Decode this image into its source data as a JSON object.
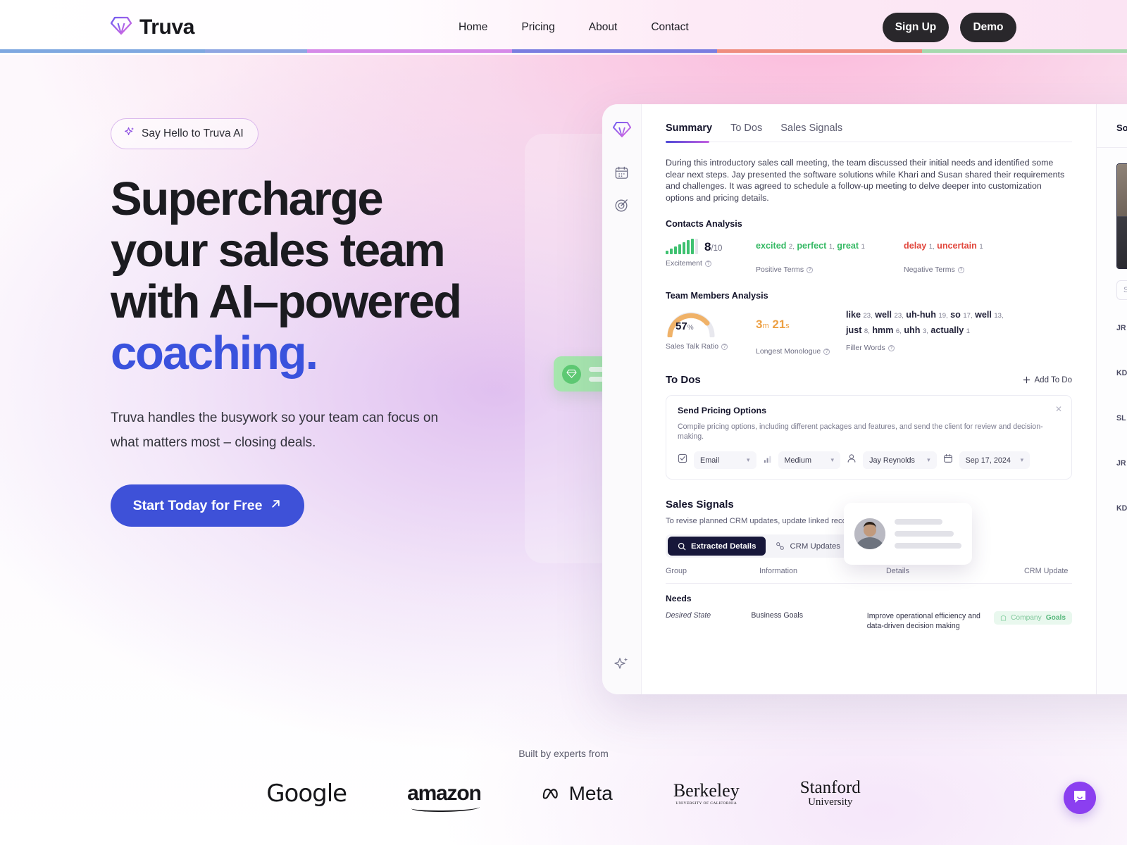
{
  "nav": {
    "brand": "Truva",
    "brand_icon": "diamond-logo-icon",
    "links": [
      {
        "label": "Home"
      },
      {
        "label": "Pricing"
      },
      {
        "label": "About"
      },
      {
        "label": "Contact"
      }
    ],
    "signup_label": "Sign Up",
    "demo_label": "Demo",
    "gradient_segments": [
      "#7fa8e0",
      "#7fa8e0",
      "#8fa6e2",
      "#d68ae8",
      "#d68ae8",
      "#7b7de0",
      "#7b7de0",
      "#ef8d7f",
      "#ef8d7f",
      "#a6d9ae",
      "#a6d9ae"
    ]
  },
  "hero": {
    "badge_icon": "sparkle-icon",
    "badge_label": "Say Hello to Truva AI",
    "title_line1": "Supercharge",
    "title_line2": "your sales team",
    "title_line3": "with AI–powered",
    "title_accent": "coaching.",
    "accent_color": "#3a52dd",
    "subtitle": "Truva handles the busywork so your team can focus on what matters most – closing deals.",
    "cta_label": "Start Today for Free",
    "cta_icon": "arrow-up-right-icon",
    "cta_color": "#3e51d8"
  },
  "dashboard": {
    "rail_icons": [
      "diamond-logo-icon",
      "calendar-icon",
      "target-icon",
      "sparkle-ai-icon"
    ],
    "tabs": [
      {
        "label": "Summary",
        "active": true
      },
      {
        "label": "To Dos",
        "active": false
      },
      {
        "label": "Sales Signals",
        "active": false
      }
    ],
    "summary_text": "During this introductory sales call meeting, the team discussed their initial needs and identified some clear next steps. Jay presented the software solutions while Khari and Susan shared their requirements and challenges. It was agreed to schedule a follow-up meeting to delve deeper into customization options and pricing details.",
    "contacts_analysis": {
      "heading": "Contacts Analysis",
      "excitement": {
        "value": "8",
        "out_of": "/10",
        "caption": "Excitement",
        "bars_filled": 7,
        "bars_total": 8
      },
      "positive": {
        "caption": "Positive Terms",
        "terms": [
          {
            "word": "excited",
            "count": "2"
          },
          {
            "word": "perfect",
            "count": "1"
          },
          {
            "word": "great",
            "count": "1"
          }
        ]
      },
      "negative": {
        "caption": "Negative Terms",
        "terms": [
          {
            "word": "delay",
            "count": "1"
          },
          {
            "word": "uncertain",
            "count": "1"
          }
        ]
      }
    },
    "team_analysis": {
      "heading": "Team Members Analysis",
      "talk_ratio": {
        "value": "57",
        "unit": "%",
        "caption": "Sales Talk Ratio",
        "percent": 57
      },
      "monologue": {
        "minutes": "3",
        "m_unit": "m",
        "seconds": "21",
        "s_unit": "s",
        "caption": "Longest Monologue"
      },
      "filler": {
        "caption": "Filler Words",
        "terms": [
          {
            "word": "like",
            "count": "23"
          },
          {
            "word": "well",
            "count": "23"
          },
          {
            "word": "uh-huh",
            "count": "19"
          },
          {
            "word": "so",
            "count": "17"
          },
          {
            "word": "well",
            "count": "13"
          },
          {
            "word": "just",
            "count": "8"
          },
          {
            "word": "hmm",
            "count": "6"
          },
          {
            "word": "uhh",
            "count": "3"
          },
          {
            "word": "actually",
            "count": "1"
          }
        ]
      }
    },
    "todos": {
      "heading": "To Dos",
      "add_label": "Add To Do",
      "add_icon": "plus-icon",
      "card": {
        "title": "Send Pricing Options",
        "description": "Compile pricing options, including different packages and features, and send the client for review and decision-making.",
        "close_icon": "close-icon",
        "controls": [
          {
            "icon": "checkbox-icon",
            "value": "Email"
          },
          {
            "icon": "priority-bars-icon",
            "value": "Medium"
          },
          {
            "icon": "person-icon",
            "value": "Jay Reynolds"
          },
          {
            "icon": "calendar-icon",
            "value": "Sep 17, 2024"
          }
        ]
      }
    },
    "sales_signals": {
      "heading": "Sales Signals",
      "description": "To revise planned CRM updates, update linked records using 'associations'.",
      "segments": [
        {
          "label": "Extracted Details",
          "icon": "search-icon",
          "active": true
        },
        {
          "label": "CRM Updates",
          "icon": "link-nodes-icon",
          "active": false
        }
      ],
      "columns": [
        "Group",
        "Information",
        "Details",
        "CRM Update"
      ],
      "group_label": "Needs",
      "rows": [
        {
          "group": "Desired State",
          "information": "Business Goals",
          "details": "Improve operational efficiency and data-driven decision making",
          "crm_update": {
            "icon": "company-icon",
            "label": "Company",
            "value": "Goals"
          }
        }
      ]
    },
    "source_panel": {
      "heading": "Source",
      "search_placeholder": "Se",
      "speakers": [
        "JR",
        "KD",
        "SL",
        "JR",
        "KD"
      ]
    }
  },
  "partners": {
    "caption": "Built by experts from",
    "logos": [
      {
        "name": "Google",
        "text": "Google"
      },
      {
        "name": "amazon",
        "text": "amazon"
      },
      {
        "name": "Meta",
        "text": "Meta"
      },
      {
        "name": "Berkeley",
        "text": "Berkeley",
        "sub": "UNIVERSITY OF CALIFORNIA"
      },
      {
        "name": "Stanford",
        "text": "Stanford",
        "sub": "University"
      }
    ]
  },
  "chat_widget": {
    "icon": "chat-smile-icon",
    "color": "#8b3ff0"
  }
}
